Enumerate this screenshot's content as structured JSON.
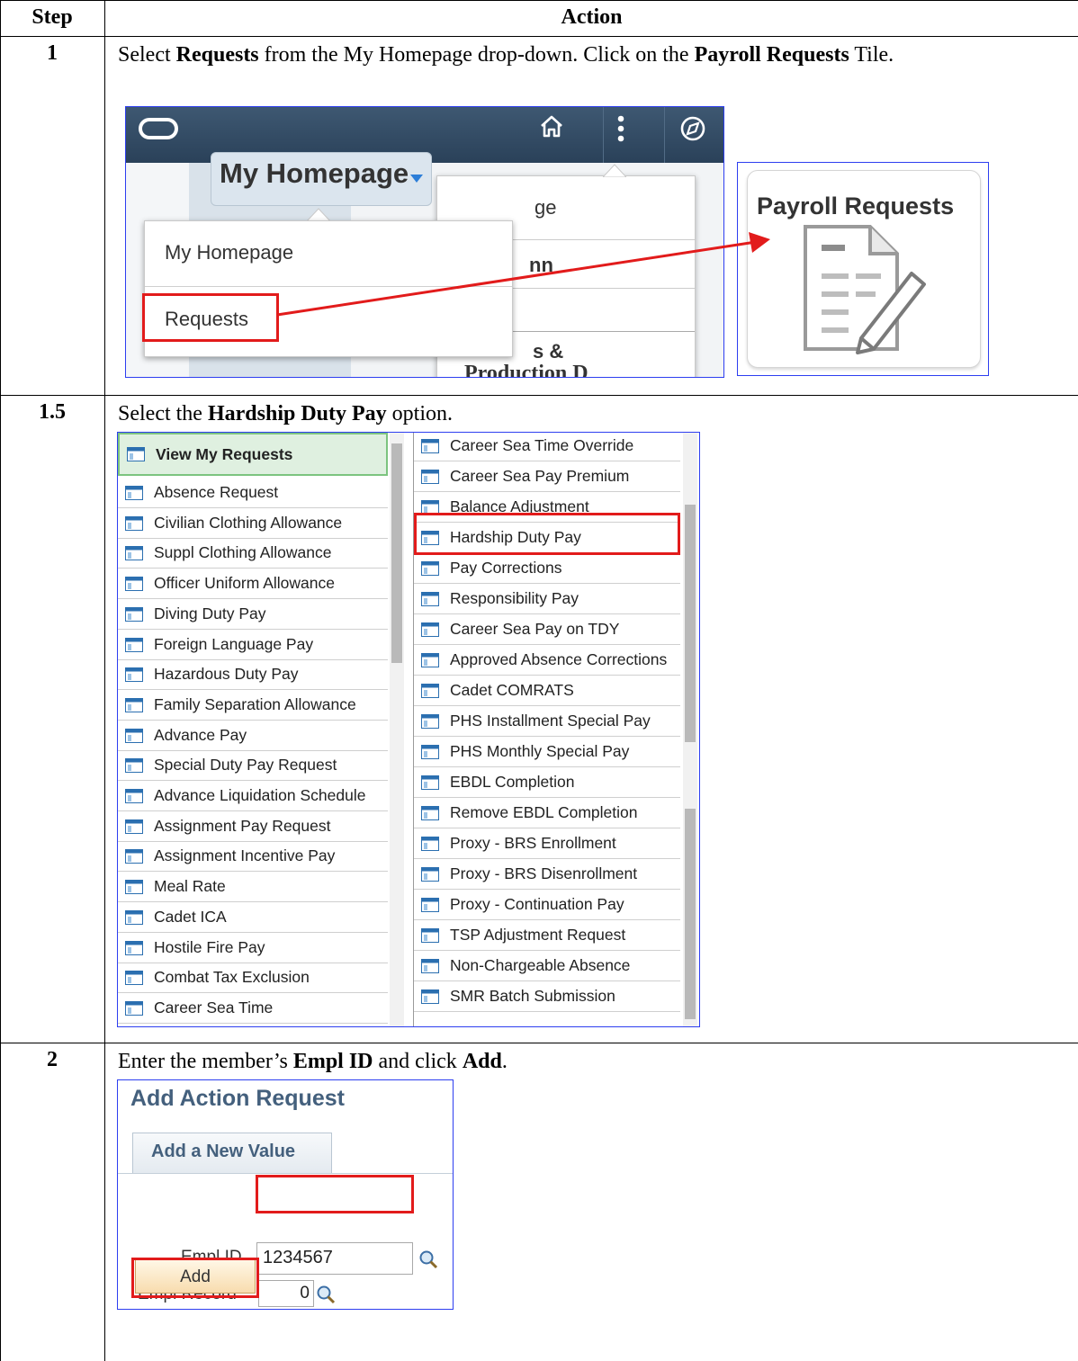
{
  "table": {
    "header_step": "Step",
    "header_action": "Action",
    "rows": [
      {
        "step": "1",
        "instruction": [
          {
            "t": "Select "
          },
          {
            "t": "Requests",
            "b": true
          },
          {
            "t": " from the My Homepage drop-down. Click on the "
          },
          {
            "t": "Payroll Requests",
            "b": true
          },
          {
            "t": " Tile."
          }
        ]
      },
      {
        "step": "1.5",
        "instruction": [
          {
            "t": "Select the "
          },
          {
            "t": "Hardship Duty Pay",
            "b": true
          },
          {
            "t": " option."
          }
        ]
      },
      {
        "step": "2",
        "instruction": [
          {
            "t": "Enter the member’s "
          },
          {
            "t": "Empl ID",
            "b": true
          },
          {
            "t": " and click "
          },
          {
            "t": "Add",
            "b": true
          },
          {
            "t": "."
          }
        ]
      }
    ]
  },
  "step1": {
    "homepage_button": "My Homepage",
    "dropdown_items": [
      "My Homepage",
      "Requests"
    ],
    "behind_fragments": [
      "ge",
      "nn",
      "s &",
      "Production D"
    ],
    "tile_title": "Payroll Requests",
    "colors": {
      "topbar": "#2f4760",
      "highlight": "#e21b1b",
      "frame": "#2d3ef0"
    }
  },
  "step15": {
    "left_header": "View My Requests",
    "left_items": [
      "Absence Request",
      "Civilian Clothing Allowance",
      "Suppl Clothing Allowance",
      "Officer Uniform Allowance",
      "Diving Duty Pay",
      "Foreign Language Pay",
      "Hazardous Duty Pay",
      "Family Separation Allowance",
      "Advance Pay",
      "Special Duty Pay Request",
      "Advance Liquidation Schedule",
      "Assignment Pay Request",
      "Assignment Incentive Pay",
      "Meal Rate",
      "Cadet ICA",
      "Hostile Fire Pay",
      "Combat Tax Exclusion",
      "Career Sea Time"
    ],
    "right_items": [
      "Career Sea Time Override",
      "Career Sea Pay Premium",
      "Balance Adjustment",
      "Hardship Duty Pay",
      "Pay Corrections",
      "Responsibility Pay",
      "Career Sea Pay on TDY",
      "Approved Absence Corrections",
      "Cadet COMRATS",
      "PHS Installment Special Pay",
      "PHS Monthly Special Pay",
      "EBDL Completion",
      "Remove EBDL Completion",
      "Proxy - BRS Enrollment",
      "Proxy - BRS Disenrollment",
      "Proxy - Continuation Pay",
      "TSP Adjustment Request",
      "Non-Chargeable Absence",
      "SMR Batch Submission"
    ],
    "selected": "Hardship Duty Pay"
  },
  "step2": {
    "title": "Add Action Request",
    "tab": "Add a New Value",
    "empl_id_label": "Empl ID",
    "empl_id_value": "1234567",
    "empl_record_label": "Empl Record",
    "empl_record_value": "0",
    "add_button": "Add"
  }
}
